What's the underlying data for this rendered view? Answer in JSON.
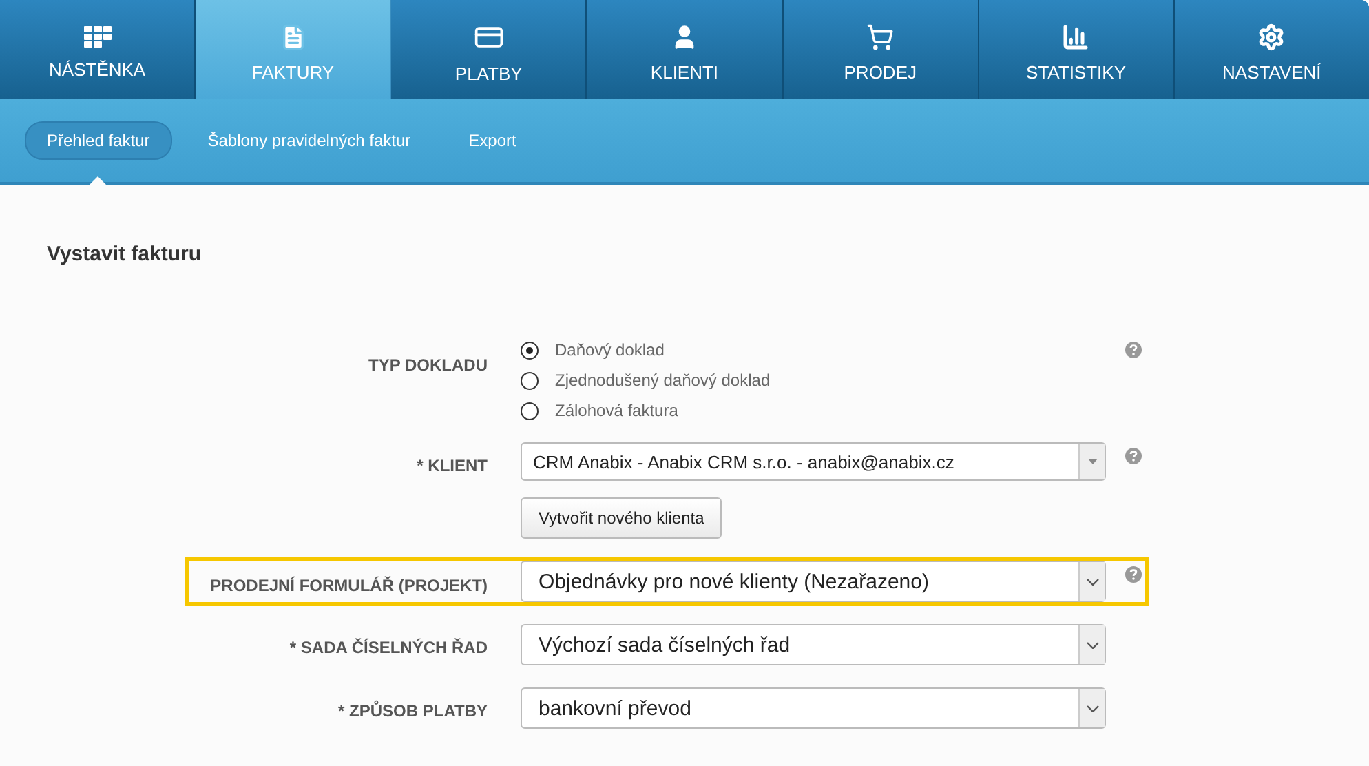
{
  "nav": [
    {
      "label": "NÁSTĚNKA",
      "selected": false
    },
    {
      "label": "FAKTURY",
      "selected": true
    },
    {
      "label": "PLATBY",
      "selected": false
    },
    {
      "label": "KLIENTI",
      "selected": false
    },
    {
      "label": "PRODEJ",
      "selected": false
    },
    {
      "label": "STATISTIKY",
      "selected": false
    },
    {
      "label": "NASTAVENÍ",
      "selected": false
    }
  ],
  "subnav": [
    {
      "label": "Přehled faktur",
      "selected": true
    },
    {
      "label": "Šablony pravidelných faktur",
      "selected": false
    },
    {
      "label": "Export",
      "selected": false
    }
  ],
  "heading": "Vystavit fakturu",
  "form": [
    {
      "kind": "radio",
      "label": "TYP DOKLADU",
      "help": true,
      "highlighted": false,
      "options": [
        {
          "label": "Daňový doklad",
          "selected": true
        },
        {
          "label": "Zjednodušený daňový doklad",
          "selected": false
        },
        {
          "label": "Zálohová faktura",
          "selected": false
        }
      ]
    },
    {
      "kind": "combo",
      "label": "* KLIENT",
      "value": "CRM Anabix - Anabix CRM s.r.o. - anabix@anabix.cz",
      "help": true,
      "highlighted": false,
      "button": "Vytvořit nového klienta"
    },
    {
      "kind": "select",
      "label": "PRODEJNÍ FORMULÁŘ (PROJEKT)",
      "value": "Objednávky pro nové klienty (Nezařazeno)",
      "help": true,
      "highlighted": true
    },
    {
      "kind": "select",
      "label": "* SADA ČÍSELNÝCH ŘAD",
      "value": "Výchozí sada číselných řad",
      "help": false,
      "highlighted": false
    },
    {
      "kind": "select",
      "label": "* ZPŮSOB PLATBY",
      "value": "bankovní převod",
      "help": false,
      "highlighted": false
    }
  ]
}
